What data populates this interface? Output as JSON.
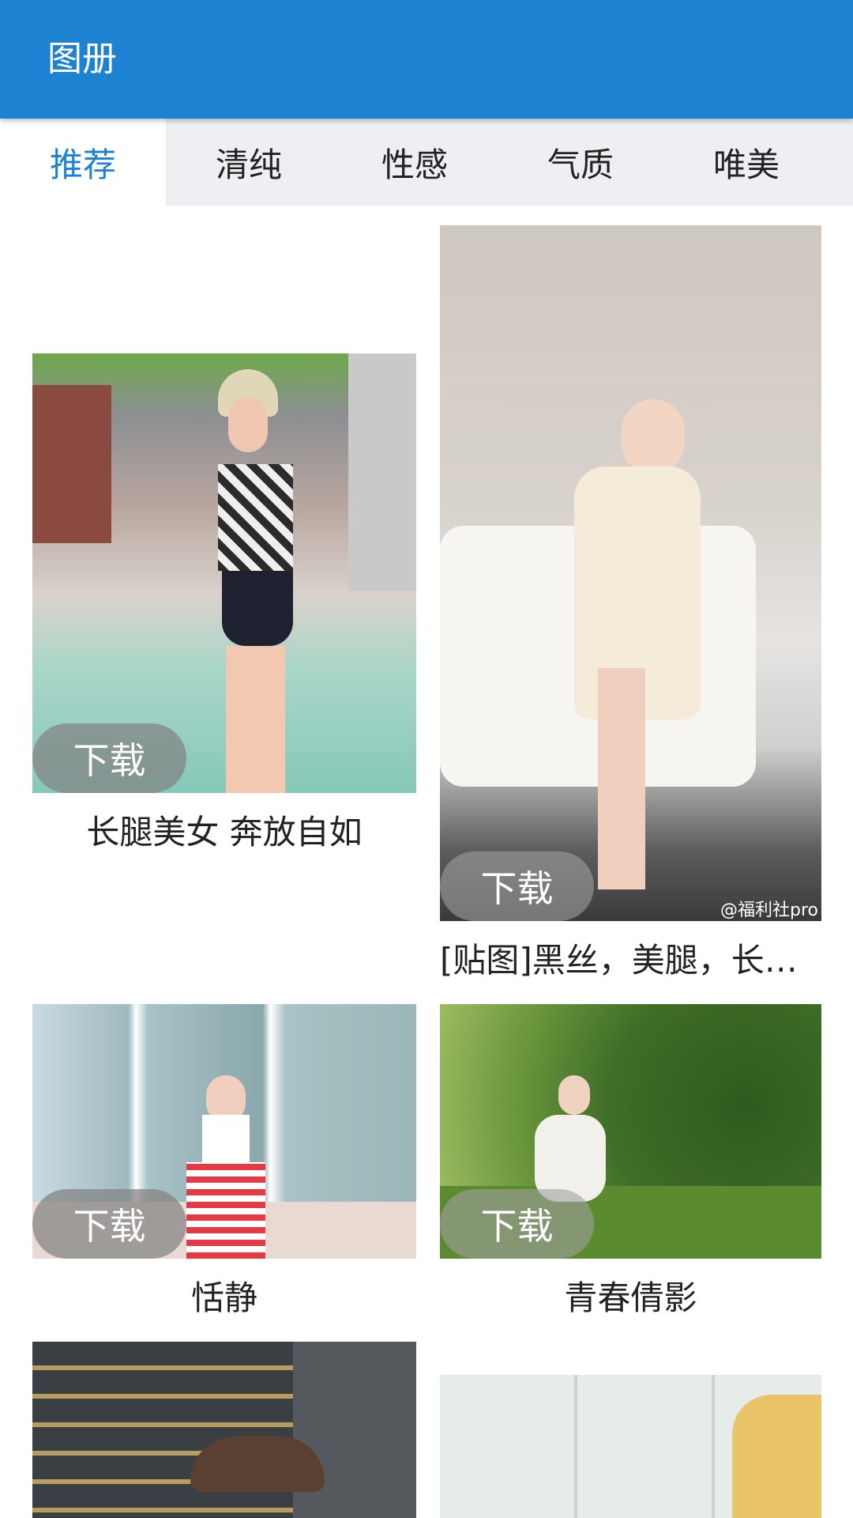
{
  "app": {
    "title": "图册"
  },
  "tabs": [
    {
      "label": "推荐",
      "active": true
    },
    {
      "label": "清纯",
      "active": false
    },
    {
      "label": "性感",
      "active": false
    },
    {
      "label": "气质",
      "active": false
    },
    {
      "label": "唯美",
      "active": false
    }
  ],
  "cards": [
    {
      "download_label": "下载",
      "caption": "长腿美女 奔放自如"
    },
    {
      "download_label": "下载",
      "caption": "[贴图]黑丝，美腿，长期..."
    },
    {
      "download_label": "下载",
      "caption": "恬静"
    },
    {
      "download_label": "下载",
      "caption": "青春倩影"
    }
  ],
  "watermarks": {
    "card2": "@福利社pro"
  },
  "colors": {
    "primary": "#1e82d2",
    "tab_bg": "#eeeff3",
    "active_tab_text": "#1e82d2"
  }
}
